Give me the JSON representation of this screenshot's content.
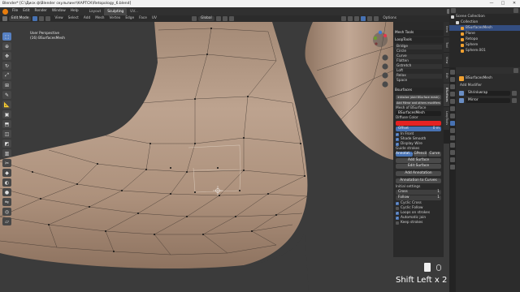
{
  "window": {
    "title": "Blender* [C:\\Диск ф\\Blender скульпинг\\КАРТСК\\Retopology_6.blend]",
    "minimize": "—",
    "maximize": "□",
    "close": "✕"
  },
  "menubar": {
    "editor_icon": "blender-logo-icon",
    "items": [
      "File",
      "Edit",
      "Render",
      "Window",
      "Help"
    ],
    "workspaces": [
      "Layout",
      "Sculpting",
      "UV..."
    ],
    "active_workspace": "Sculpting",
    "scene_label": "Scene",
    "view_layer_label": "View Layer"
  },
  "viewport_header": {
    "mode": "Edit Mode",
    "menus": [
      "View",
      "Select",
      "Add",
      "Mesh",
      "Vertex",
      "Edge",
      "Face",
      "UV"
    ],
    "transform_orientation": "Global",
    "options_label": "Options"
  },
  "viewport": {
    "view_name": "User Perspective",
    "object_name": "(16) BSurfacesMesh",
    "accent_color": "#ff9a1f",
    "mesh_color": "#b39680"
  },
  "toolbar": {
    "tools": [
      "select-box-icon",
      "cursor-icon",
      "move-icon",
      "rotate-icon",
      "scale-icon",
      "transform-icon",
      "annotate-icon",
      "measure-icon",
      "add-cube-icon",
      "extrude-icon",
      "inset-icon",
      "bevel-icon",
      "loop-cut-icon",
      "knife-icon",
      "poly-build-icon",
      "spin-icon",
      "smooth-icon",
      "edge-slide-icon",
      "shrink-icon",
      "shear-icon",
      "rip-icon"
    ]
  },
  "npanel": {
    "mesh_tools": "Mesh Tools",
    "looptools": {
      "title": "LoopTools",
      "items": [
        "Bridge",
        "Circle",
        "Curve",
        "Flatten",
        "Gstretch",
        "Loft",
        "Relax",
        "Space"
      ]
    },
    "bsurfaces": {
      "title": "Bsurfaces",
      "initialize_button": "Initialize (Add BSurface mesh)",
      "add_mirror_button": "Add Mirror and others modifiers",
      "mesh_label": "Mesh of BSurface",
      "mesh_value": "BSurfacesMesh",
      "color_label": "Diffuse Color",
      "color_value": "#e52222",
      "offset_label": "Offset",
      "offset_value": "0 m",
      "in_front": "In Front",
      "shade_smooth": "Shade Smooth",
      "display_wire": "Display Wire",
      "guide_label": "Guide strokes",
      "guide_tabs": [
        "Annotat...",
        "GPencil",
        "Curve"
      ],
      "active_guide_tab": "Annotat...",
      "add_surface": "Add Surface",
      "edit_surface": "Edit Surface",
      "add_annotation": "Add Annotation",
      "annotation_to_curves": "Annotation to Curves",
      "initial_settings": "Initial settings",
      "cross_label": "Cross",
      "cross_value": "1",
      "follow_label": "Follow",
      "follow_value": "1",
      "cyclic_cross": "Cyclic Cross",
      "cyclic_follow": "Cyclic Follow",
      "loops_on_strokes": "Loops on strokes",
      "automatic_join": "Automatic join",
      "keep_strokes": "Keep strokes"
    },
    "tabs": [
      "Item",
      "Tool",
      "View",
      "Edit",
      "BSurfaces",
      "LoopTools"
    ]
  },
  "outliner": {
    "title": "Scene Collection",
    "rows": [
      {
        "label": "Scene Collection",
        "color": "#d6d6d6",
        "indent": 0
      },
      {
        "label": "Collection",
        "color": "#d6d6d6",
        "indent": 1
      },
      {
        "label": "BSurfacesMesh",
        "color": "#f0a030",
        "indent": 2,
        "selected": true
      },
      {
        "label": "Plane",
        "color": "#f0a030",
        "indent": 2
      },
      {
        "label": "Retopo",
        "color": "#f0a030",
        "indent": 2
      },
      {
        "label": "Sphere",
        "color": "#f0a030",
        "indent": 2
      },
      {
        "label": "Sphere.001",
        "color": "#f0a030",
        "indent": 2
      }
    ]
  },
  "properties": {
    "object_name": "BSurfacesMesh",
    "add_modifier": "Add Modifier",
    "modifiers": [
      {
        "name": "Shrinkwrap"
      },
      {
        "name": "Mirror"
      }
    ]
  },
  "keycast": {
    "text": "Shift Left x 2"
  }
}
